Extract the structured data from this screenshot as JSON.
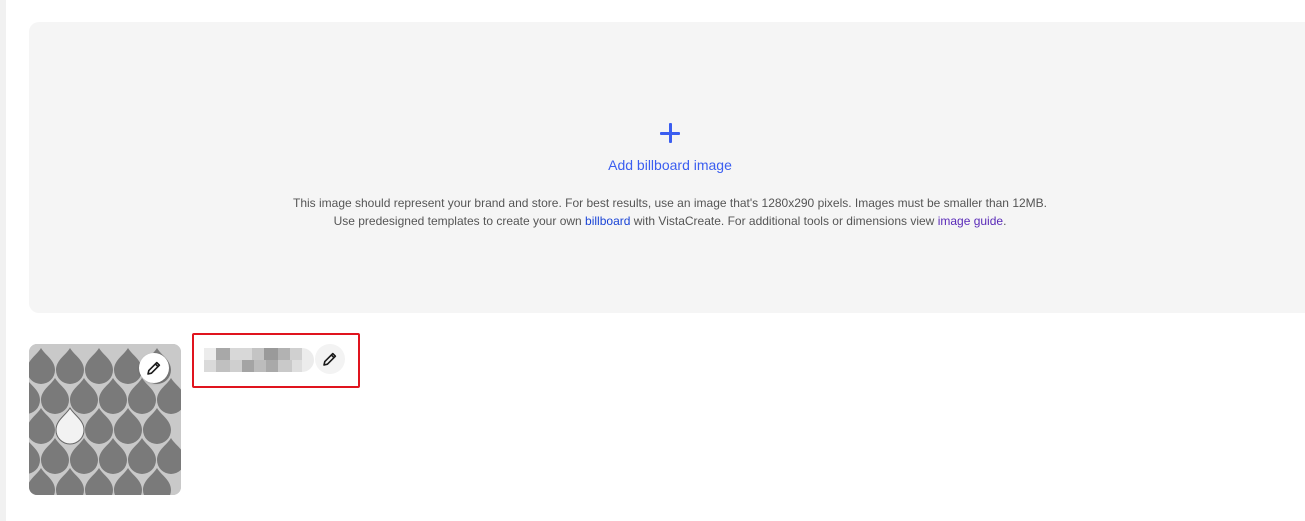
{
  "billboard": {
    "add_label": "Add billboard image",
    "help_line1": "This image should represent your brand and store. For best results, use an image that's 1280x290 pixels. Images must be smaller than 12MB.",
    "help_line2_pre": "Use predesigned templates to create your own ",
    "help_link_billboard": "billboard",
    "help_line2_mid": " with VistaCreate. For additional tools or dimensions view ",
    "help_link_guide": "image guide",
    "help_line2_post": "."
  },
  "icons": {
    "add": "plus-icon",
    "edit_logo": "pencil-icon",
    "edit_name": "pencil-icon"
  },
  "colors": {
    "accent": "#3b5ef0",
    "link_billboard": "#1a44d6",
    "link_guide": "#5a2ab8",
    "highlight": "#e0141e",
    "panel_bg": "#f5f5f5"
  }
}
